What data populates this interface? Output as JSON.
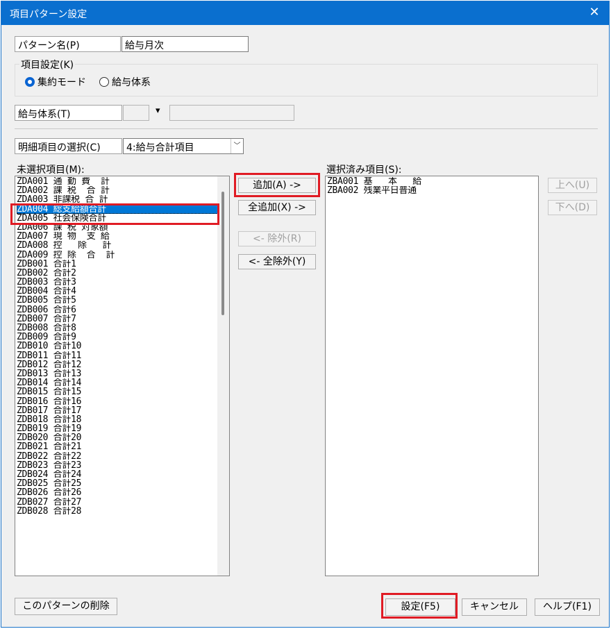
{
  "window": {
    "title": "項目パターン設定",
    "close": "✕"
  },
  "pattern": {
    "label": "パターン名(P)",
    "value": "給与月次"
  },
  "item_setting": {
    "label": "項目設定(K)",
    "mode_aggregate": "集約モード",
    "mode_salary": "給与体系"
  },
  "salary_system": {
    "label": "給与体系(T)",
    "arrow": "▾"
  },
  "detail": {
    "label": "明細項目の選択(C)",
    "value": "4:給与合計項目",
    "arrow": "﹀"
  },
  "unselected": {
    "label": "未選択項目(M):",
    "items": [
      "ZDA001 通 勤 費  計",
      "ZDA002 課 税  合 計",
      "ZDA003 非課税 合 計",
      "ZDA004 総支給額合計",
      "ZDA005 社会保険合計",
      "ZDA006 課 税 対象額",
      "ZDA007 現 物  支 給",
      "ZDA008 控   除   計",
      "ZDA009 控 除  合  計",
      "ZDB001 合計1",
      "ZDB002 合計2",
      "ZDB003 合計3",
      "ZDB004 合計4",
      "ZDB005 合計5",
      "ZDB006 合計6",
      "ZDB007 合計7",
      "ZDB008 合計8",
      "ZDB009 合計9",
      "ZDB010 合計10",
      "ZDB011 合計11",
      "ZDB012 合計12",
      "ZDB013 合計13",
      "ZDB014 合計14",
      "ZDB015 合計15",
      "ZDB016 合計16",
      "ZDB017 合計17",
      "ZDB018 合計18",
      "ZDB019 合計19",
      "ZDB020 合計20",
      "ZDB021 合計21",
      "ZDB022 合計22",
      "ZDB023 合計23",
      "ZDB024 合計24",
      "ZDB025 合計25",
      "ZDB026 合計26",
      "ZDB027 合計27",
      "ZDB028 合計28"
    ]
  },
  "selected": {
    "label": "選択済み項目(S):",
    "items": [
      "ZBA001 基   本   給",
      "ZBA002 残業平日普通"
    ]
  },
  "buttons": {
    "add": "追加(A) ->",
    "add_all": "全追加(X) ->",
    "remove": "<- 除外(R)",
    "remove_all": "<- 全除外(Y)",
    "up": "上へ(U)",
    "down": "下へ(D)",
    "delete_pattern": "このパターンの削除",
    "ok": "設定(F5)",
    "cancel": "キャンセル",
    "help": "ヘルプ(F1)"
  },
  "colors": {
    "titlebar": "#0a6fcf",
    "selection": "#0078d7",
    "highlight": "#e01b24"
  }
}
